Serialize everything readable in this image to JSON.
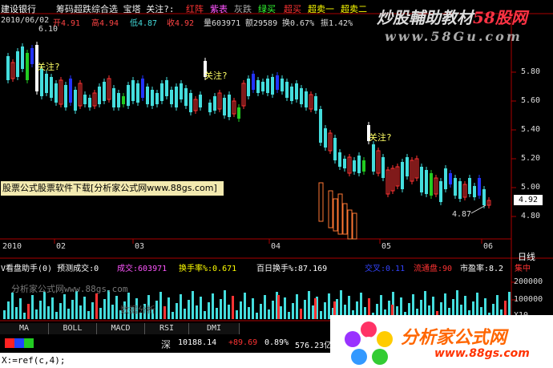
{
  "header": {
    "stock_name": "建设银行",
    "indicator_title": "筹码超跌综合选 宝塔 关注?:",
    "legend_red": "红阵",
    "legend_magenta": "紫表",
    "legend_gray": "灰跌",
    "legend_green": "绿买",
    "legend_red2": "超买",
    "legend_yellow": "超卖一",
    "legend_yellow2": "超卖二"
  },
  "ohlc_bar": {
    "date": "2010/06/02",
    "open": "开4.91",
    "high": "高4.94",
    "low": "低4.87",
    "close": "收4.92",
    "volume": "量603971",
    "amount": "额29589",
    "turnover": "换0.67%",
    "amplitude": "振1.42%"
  },
  "watermark": {
    "title": "炒股輔助教材",
    "site": "58股网",
    "url": "www.58Gu.com"
  },
  "price_axis": [
    "5.80",
    "5.60",
    "5.40",
    "5.20",
    "5.00",
    "4.80"
  ],
  "current_price": "4.92",
  "high_mark": "6.10",
  "low_mark": "4.87",
  "annotations": [
    "关注?",
    "关注?",
    "关注?"
  ],
  "ad_banner": "股票公式股票软件下载[分析家公式网www.88gs.com]",
  "date_axis": {
    "year": "2010",
    "months": [
      "02",
      "03",
      "04",
      "05",
      "06"
    ],
    "label": "日线"
  },
  "sub_indicator": {
    "name": "V看盘助手(0) 预测成交:0",
    "vol_label": "成交:603971",
    "turnover_label": "换手率%:0.671",
    "turnover100_label": "百日换手%:87.169",
    "cross_label": "交叉:0.11",
    "flow_label": "流通盘:90",
    "pe_label": "市盈率:8.2",
    "conc_label": "集中"
  },
  "volume_axis": {
    "top": "200000",
    "mid": "100000",
    "unit": "X10"
  },
  "sub_watermark": "分析家公式网www.88gs.com",
  "sub_watermark2": "数据分析",
  "tabs": [
    "MA",
    "BOLL",
    "MACD",
    "RSI",
    "DMI"
  ],
  "status": {
    "index_name": "深",
    "index_value": "10188.14",
    "change": "+89.69",
    "pct": "0.89%",
    "amount": "576.23亿"
  },
  "formula_bar": "X:=ref(c,4);",
  "logo": {
    "name": "分析家公式网",
    "url": "www.88gs.com"
  },
  "colors": {
    "up": "#ff3333",
    "down": "#44dddd",
    "green": "#22cc22",
    "blue": "#2233ff",
    "white": "#ffffff",
    "yellow": "#ffff00"
  }
}
